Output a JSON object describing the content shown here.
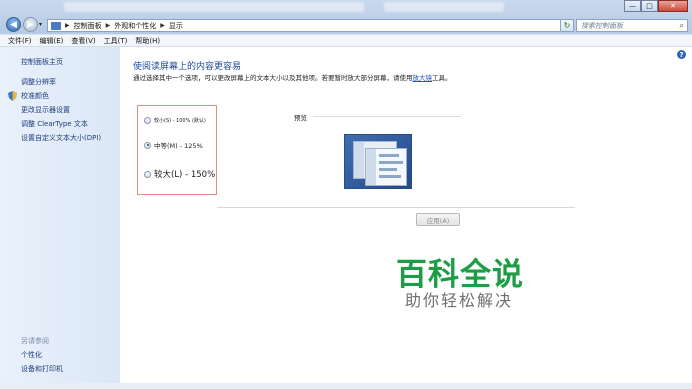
{
  "window": {
    "controls": {
      "minimize": "—",
      "maximize": "□",
      "close": "✕"
    }
  },
  "navigation": {
    "back_icon": "back-arrow-icon",
    "forward_icon": "forward-arrow-icon",
    "breadcrumbs": [
      "控制面板",
      "外观和个性化",
      "显示"
    ],
    "search_placeholder": "搜索控制面板"
  },
  "menubar": {
    "items": [
      "文件(F)",
      "编辑(E)",
      "查看(V)",
      "工具(T)",
      "帮助(H)"
    ]
  },
  "sidebar": {
    "home": "控制面板主页",
    "links": [
      "调整分辨率",
      "校准颜色",
      "更改显示器设置",
      "调整 ClearType 文本",
      "设置自定义文本大小(DPI)"
    ],
    "see_also_title": "另请参阅",
    "see_also": [
      "个性化",
      "设备和打印机"
    ]
  },
  "main": {
    "heading": "使阅读屏幕上的内容更容易",
    "description": "通过选择其中一个选项，可以更改屏幕上的文本大小以及其他项。若要暂时放大部分屏幕，请使用",
    "description_link": "放大镜",
    "description_tail": "工具。",
    "options": [
      {
        "label": "较小(S) - 100% (默认)",
        "selected": false
      },
      {
        "label": "中等(M) - 125%",
        "selected": true
      },
      {
        "label": "较大(L) - 150%",
        "selected": false
      }
    ],
    "preview_label": "预览",
    "apply_button": "应用(A)"
  },
  "watermark": {
    "title": "百科全说",
    "subtitle": "助你轻松解决"
  },
  "colors": {
    "accent": "#1d4a9c",
    "watermark_green": "#1d9d45",
    "option_border": "#e08a83"
  }
}
